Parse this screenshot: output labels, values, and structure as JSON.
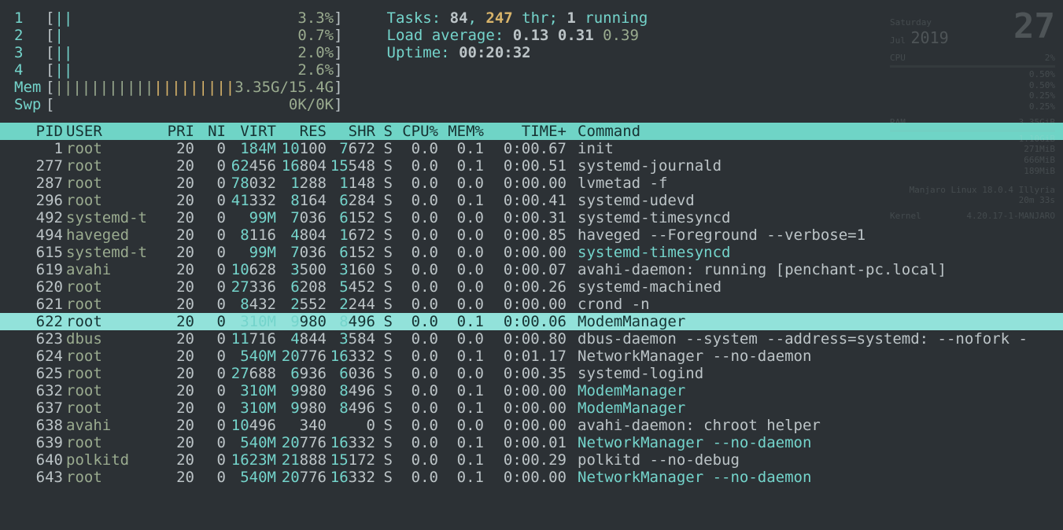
{
  "cpu": [
    {
      "id": "1",
      "bars": "||",
      "type": "c",
      "pct": "3.3%"
    },
    {
      "id": "2",
      "bars": "|",
      "type": "c",
      "pct": "0.7%"
    },
    {
      "id": "3",
      "bars": "||",
      "type": "c",
      "pct": "2.0%"
    },
    {
      "id": "4",
      "bars": "||",
      "type": "c",
      "pct": "2.6%"
    }
  ],
  "mem": {
    "label": "Mem",
    "bars_g": "|||||||||||",
    "bars_y": "|||||||||",
    "pct": "3.35G/15.4G"
  },
  "swp": {
    "label": "Swp",
    "pct": "0K/0K"
  },
  "stats": {
    "tasks_lbl": "Tasks: ",
    "tasks_a": "84",
    "sep1": ", ",
    "tasks_b": "247",
    "thr_lbl": " thr; ",
    "running": "1",
    "running_lbl": " running",
    "load_lbl": "Load average: ",
    "l1": "0.13",
    "l2": "0.31",
    "l3": "0.39",
    "uptime_lbl": "Uptime: ",
    "uptime": "00:20:32"
  },
  "columns": {
    "pid": "PID",
    "user": "USER",
    "pri": "PRI",
    "ni": "NI",
    "virt": "VIRT",
    "res": "RES",
    "shr": "SHR",
    "s": "S",
    "cpu": "CPU%",
    "mem": "MEM%",
    "time": "TIME+",
    "cmd": "Command"
  },
  "procs": [
    {
      "pid": "1",
      "user": "root",
      "pri": "20",
      "ni": "0",
      "virt": "184M",
      "virt_hi": "184M",
      "res": "10100",
      "res_hi": "10",
      "shr": "7672",
      "shr_hi": "7",
      "s": "S",
      "cpu": "0.0",
      "mem": "0.1",
      "time": "0:00.67",
      "cmd": "init"
    },
    {
      "pid": "277",
      "user": "root",
      "pri": "20",
      "ni": "0",
      "virt": "62456",
      "virt_hi": "62",
      "res": "16804",
      "res_hi": "16",
      "shr": "15548",
      "shr_hi": "15",
      "s": "S",
      "cpu": "0.0",
      "mem": "0.1",
      "time": "0:00.51",
      "cmd": "systemd-journald"
    },
    {
      "pid": "287",
      "user": "root",
      "pri": "20",
      "ni": "0",
      "virt": "78032",
      "virt_hi": "78",
      "res": "1288",
      "res_hi": "1",
      "shr": "1148",
      "shr_hi": "1",
      "s": "S",
      "cpu": "0.0",
      "mem": "0.0",
      "time": "0:00.00",
      "cmd": "lvmetad -f"
    },
    {
      "pid": "296",
      "user": "root",
      "pri": "20",
      "ni": "0",
      "virt": "41332",
      "virt_hi": "41",
      "res": "8164",
      "res_hi": "8",
      "shr": "6284",
      "shr_hi": "6",
      "s": "S",
      "cpu": "0.0",
      "mem": "0.1",
      "time": "0:00.41",
      "cmd": "systemd-udevd"
    },
    {
      "pid": "492",
      "user": "systemd-t",
      "pri": "20",
      "ni": "0",
      "virt": "99M",
      "virt_hi": "99M",
      "res": "7036",
      "res_hi": "7",
      "shr": "6152",
      "shr_hi": "6",
      "s": "S",
      "cpu": "0.0",
      "mem": "0.0",
      "time": "0:00.31",
      "cmd": "systemd-timesyncd"
    },
    {
      "pid": "494",
      "user": "haveged",
      "pri": "20",
      "ni": "0",
      "virt": "8116",
      "virt_hi": "8",
      "res": "4804",
      "res_hi": "4",
      "shr": "1672",
      "shr_hi": "1",
      "s": "S",
      "cpu": "0.0",
      "mem": "0.0",
      "time": "0:00.85",
      "cmd": "haveged --Foreground --verbose=1"
    },
    {
      "pid": "615",
      "user": "systemd-t",
      "pri": "20",
      "ni": "0",
      "virt": "99M",
      "virt_hi": "99M",
      "res": "7036",
      "res_hi": "7",
      "shr": "6152",
      "shr_hi": "6",
      "s": "S",
      "cpu": "0.0",
      "mem": "0.0",
      "time": "0:00.00",
      "cmd": "systemd-timesyncd",
      "fade": true
    },
    {
      "pid": "619",
      "user": "avahi",
      "pri": "20",
      "ni": "0",
      "virt": "10628",
      "virt_hi": "10",
      "res": "3500",
      "res_hi": "3",
      "shr": "3160",
      "shr_hi": "3",
      "s": "S",
      "cpu": "0.0",
      "mem": "0.0",
      "time": "0:00.07",
      "cmd": "avahi-daemon: running [penchant-pc.local]"
    },
    {
      "pid": "620",
      "user": "root",
      "pri": "20",
      "ni": "0",
      "virt": "27336",
      "virt_hi": "27",
      "res": "6208",
      "res_hi": "6",
      "shr": "5452",
      "shr_hi": "5",
      "s": "S",
      "cpu": "0.0",
      "mem": "0.0",
      "time": "0:00.26",
      "cmd": "systemd-machined"
    },
    {
      "pid": "621",
      "user": "root",
      "pri": "20",
      "ni": "0",
      "virt": "8432",
      "virt_hi": "8",
      "res": "2552",
      "res_hi": "2",
      "shr": "2244",
      "shr_hi": "2",
      "s": "S",
      "cpu": "0.0",
      "mem": "0.0",
      "time": "0:00.00",
      "cmd": "crond -n"
    },
    {
      "pid": "622",
      "user": "root",
      "pri": "20",
      "ni": "0",
      "virt": "310M",
      "virt_hi": "310M",
      "res": "9980",
      "res_hi": "9",
      "shr": "8496",
      "shr_hi": "8",
      "s": "S",
      "cpu": "0.0",
      "mem": "0.1",
      "time": "0:00.06",
      "cmd": "ModemManager",
      "sel": true
    },
    {
      "pid": "623",
      "user": "dbus",
      "pri": "20",
      "ni": "0",
      "virt": "11716",
      "virt_hi": "11",
      "res": "4844",
      "res_hi": "4",
      "shr": "3584",
      "shr_hi": "3",
      "s": "S",
      "cpu": "0.0",
      "mem": "0.0",
      "time": "0:00.80",
      "cmd": "dbus-daemon --system --address=systemd: --nofork -"
    },
    {
      "pid": "624",
      "user": "root",
      "pri": "20",
      "ni": "0",
      "virt": "540M",
      "virt_hi": "540M",
      "res": "20776",
      "res_hi": "20",
      "shr": "16332",
      "shr_hi": "16",
      "s": "S",
      "cpu": "0.0",
      "mem": "0.1",
      "time": "0:01.17",
      "cmd": "NetworkManager --no-daemon"
    },
    {
      "pid": "625",
      "user": "root",
      "pri": "20",
      "ni": "0",
      "virt": "27688",
      "virt_hi": "27",
      "res": "6936",
      "res_hi": "6",
      "shr": "6036",
      "shr_hi": "6",
      "s": "S",
      "cpu": "0.0",
      "mem": "0.0",
      "time": "0:00.35",
      "cmd": "systemd-logind"
    },
    {
      "pid": "632",
      "user": "root",
      "pri": "20",
      "ni": "0",
      "virt": "310M",
      "virt_hi": "310M",
      "res": "9980",
      "res_hi": "9",
      "shr": "8496",
      "shr_hi": "8",
      "s": "S",
      "cpu": "0.0",
      "mem": "0.1",
      "time": "0:00.00",
      "cmd": "ModemManager",
      "fade": true
    },
    {
      "pid": "637",
      "user": "root",
      "pri": "20",
      "ni": "0",
      "virt": "310M",
      "virt_hi": "310M",
      "res": "9980",
      "res_hi": "9",
      "shr": "8496",
      "shr_hi": "8",
      "s": "S",
      "cpu": "0.0",
      "mem": "0.1",
      "time": "0:00.00",
      "cmd": "ModemManager",
      "fade": true
    },
    {
      "pid": "638",
      "user": "avahi",
      "pri": "20",
      "ni": "0",
      "virt": "10496",
      "virt_hi": "10",
      "res": "340",
      "res_hi": "",
      "shr": "0",
      "shr_hi": "",
      "s": "S",
      "cpu": "0.0",
      "mem": "0.0",
      "time": "0:00.00",
      "cmd": "avahi-daemon: chroot helper"
    },
    {
      "pid": "639",
      "user": "root",
      "pri": "20",
      "ni": "0",
      "virt": "540M",
      "virt_hi": "540M",
      "res": "20776",
      "res_hi": "20",
      "shr": "16332",
      "shr_hi": "16",
      "s": "S",
      "cpu": "0.0",
      "mem": "0.1",
      "time": "0:00.01",
      "cmd": "NetworkManager --no-daemon",
      "fade": true
    },
    {
      "pid": "640",
      "user": "polkitd",
      "pri": "20",
      "ni": "0",
      "virt": "1623M",
      "virt_hi": "1623M",
      "res": "21888",
      "res_hi": "21",
      "shr": "15172",
      "shr_hi": "15",
      "s": "S",
      "cpu": "0.0",
      "mem": "0.1",
      "time": "0:00.29",
      "cmd": "polkitd --no-debug"
    },
    {
      "pid": "643",
      "user": "root",
      "pri": "20",
      "ni": "0",
      "virt": "540M",
      "virt_hi": "540M",
      "res": "20776",
      "res_hi": "20",
      "shr": "16332",
      "shr_hi": "16",
      "s": "S",
      "cpu": "0.0",
      "mem": "0.1",
      "time": "0:00.00",
      "cmd": "NetworkManager --no-daemon",
      "fade": true
    }
  ],
  "conky": {
    "day": "Saturday",
    "mon": "Jul",
    "dnum": "27",
    "year": "2019",
    "cpu_lbl": "CPU",
    "cpu_pct": "2%",
    "cores": [
      "0.50%",
      "0.50%",
      "0.25%",
      "0.25%"
    ],
    "ram_lbl": "RAM",
    "ram_val": "3.35GiB",
    "ram_lines": [
      "1.10GiB",
      "271MiB",
      "666MiB",
      "189MiB"
    ],
    "distro": "Manjaro Linux 18.0.4 Illyria",
    "uptime": "20m 33s",
    "kernel": "4.20.17-1-MANJARO",
    "klbl": "Kernel"
  }
}
